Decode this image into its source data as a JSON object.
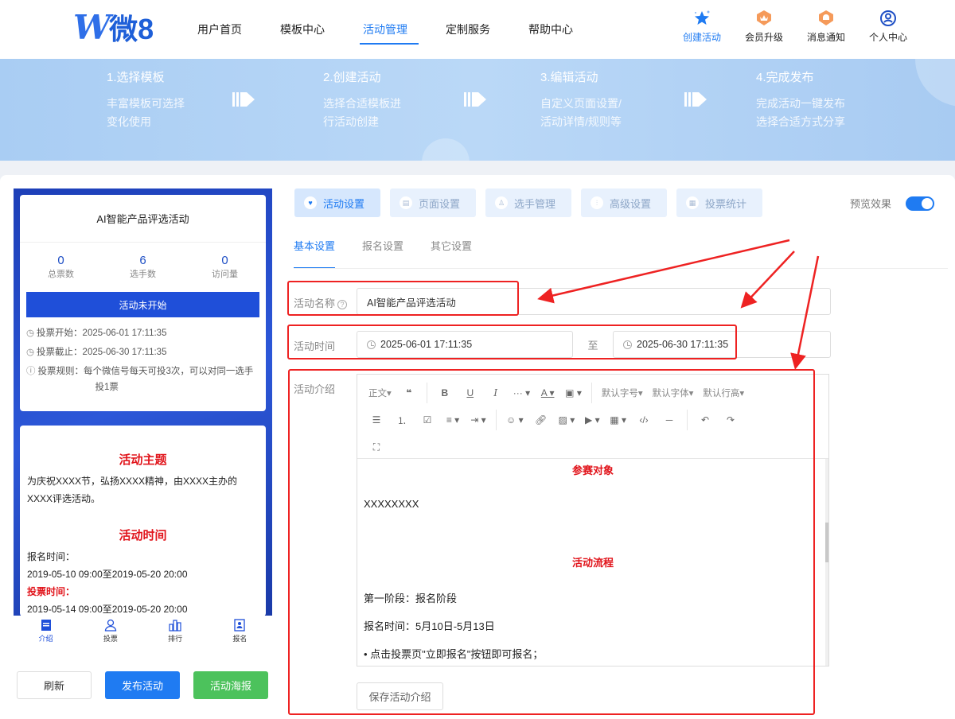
{
  "header": {
    "logo_text": "微8",
    "nav": [
      "用户首页",
      "模板中心",
      "活动管理",
      "定制服务",
      "帮助中心"
    ],
    "tools": [
      "创建活动",
      "会员升级",
      "消息通知",
      "个人中心"
    ]
  },
  "banner": {
    "steps": [
      {
        "title": "1.选择模板",
        "desc1": "丰富模板可选择",
        "desc2": "变化使用"
      },
      {
        "title": "2.创建活动",
        "desc1": "选择合适模板进",
        "desc2": "行活动创建"
      },
      {
        "title": "3.编辑活动",
        "desc1": "自定义页面设置/",
        "desc2": "活动详情/规则等"
      },
      {
        "title": "4.完成发布",
        "desc1": "完成活动一键发布",
        "desc2": "选择合适方式分享"
      }
    ]
  },
  "phone": {
    "title": "AI智能产品评选活动",
    "stats": [
      {
        "num": "0",
        "label": "总票数"
      },
      {
        "num": "6",
        "label": "选手数"
      },
      {
        "num": "0",
        "label": "访问量"
      }
    ],
    "status": "活动未开始",
    "vote_start": "投票开始：2025-06-01 17:11:35",
    "vote_end": "投票截止：2025-06-30 17:11:35",
    "rule_line1": "投票规则：每个微信号每天可投3次，可以对同一选手",
    "rule_line2": "投1票",
    "theme_title": "活动主题",
    "theme_text": "为庆祝XXXX节，弘扬XXXX精神，由XXXX主办的XXXX评选活动。",
    "time_title": "活动时间",
    "signup_label": "报名时间：",
    "signup_time": "2019-05-10 09:00至2019-05-20 20:00",
    "vote_label": "投票时间：",
    "vote_time": "2019-05-14 09:00至2019-05-20 20:00",
    "tabs": [
      "介绍",
      "投票",
      "排行",
      "报名"
    ]
  },
  "buttons": {
    "refresh": "刷新",
    "publish": "发布活动",
    "poster": "活动海报",
    "save_intro": "保存活动介绍"
  },
  "settings": {
    "tabs": [
      "活动设置",
      "页面设置",
      "选手管理",
      "高级设置",
      "投票统计"
    ],
    "preview_label": "预览效果",
    "subtabs": [
      "基本设置",
      "报名设置",
      "其它设置"
    ]
  },
  "form": {
    "name_label": "活动名称",
    "name_help": "?",
    "name_value": "AI智能产品评选活动",
    "time_label": "活动时间",
    "start": "2025-06-01 17:11:35",
    "to": "至",
    "end": "2025-06-30 17:11:35",
    "intro_label": "活动介绍"
  },
  "editor": {
    "toolbar_text": {
      "paragraph": "正文",
      "font_size": "默认字号",
      "font_family": "默认字体",
      "line_height": "默认行高"
    },
    "content": {
      "h1": "参赛对象",
      "p1": "XXXXXXXX",
      "h2": "活动流程",
      "p2": "第一阶段：报名阶段",
      "p3": "报名时间：5月10日-5月13日",
      "p4": "• 点击投票页\"立即报名\"按钮即可报名；"
    }
  }
}
